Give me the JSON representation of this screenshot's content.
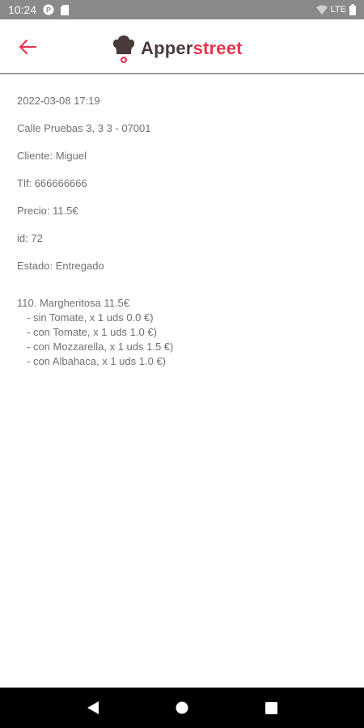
{
  "status_bar": {
    "time": "10:24",
    "network": "LTE"
  },
  "header": {
    "logo_part1": "Apper",
    "logo_part2": "street"
  },
  "order": {
    "date": "2022-03-08 17:19",
    "address": "Calle Pruebas 3, 3 3  - 07001",
    "client": "Cliente: Miguel",
    "phone": "Tlf: 666666666",
    "price": "Precio: 11.5€",
    "id": "id: 72",
    "status": "Estado: Entregado",
    "item_title": "110. Margheritosa 11.5€",
    "extras": [
      "- sin Tomate, x 1 uds 0.0 €)",
      "- con Tomate, x 1 uds 1.0 €)",
      "- con Mozzarella, x 1 uds 1.5 €)",
      "- con Albahaca, x 1 uds 1.0 €)"
    ]
  },
  "colors": {
    "accent": "#e8344e",
    "logo_dark": "#4a3b3b",
    "text": "#707070"
  }
}
